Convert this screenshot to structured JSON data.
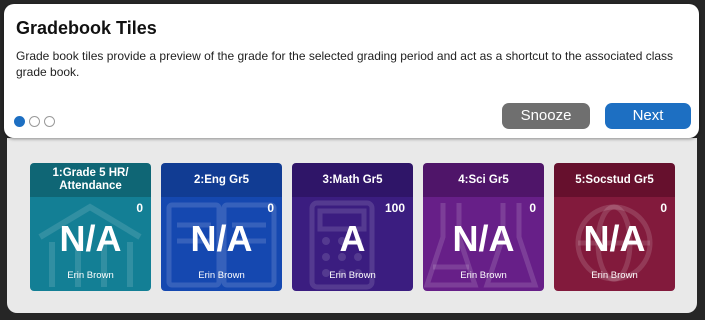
{
  "tour": {
    "title": "Gradebook Tiles",
    "description": "Grade book tiles provide a preview of the grade for the selected grading period and act as a shortcut to the associated class grade book.",
    "steps_total": 3,
    "step_active": 1,
    "snooze_label": "Snooze",
    "next_label": "Next"
  },
  "tiles": [
    {
      "name": "1:Grade 5 HR/ Attendance",
      "score": "0",
      "grade": "N/A",
      "teacher": "Erin Brown",
      "head_color": "#0f6675",
      "body_color": "#137f95",
      "icon": "building-icon"
    },
    {
      "name": "2:Eng Gr5",
      "score": "0",
      "grade": "N/A",
      "teacher": "Erin Brown",
      "head_color": "#113c93",
      "body_color": "#1548b0",
      "icon": "book-icon"
    },
    {
      "name": "3:Math Gr5",
      "score": "100",
      "grade": "A",
      "teacher": "Erin Brown",
      "head_color": "#2f1568",
      "body_color": "#3b1d80",
      "icon": "calculator-icon"
    },
    {
      "name": "4:Sci Gr5",
      "score": "0",
      "grade": "N/A",
      "teacher": "Erin Brown",
      "head_color": "#4f1569",
      "body_color": "#671f88",
      "icon": "flask-icon"
    },
    {
      "name": "5:Socstud Gr5",
      "score": "0",
      "grade": "N/A",
      "teacher": "Erin Brown",
      "head_color": "#66102d",
      "body_color": "#821a3c",
      "icon": "globe-icon"
    }
  ]
}
